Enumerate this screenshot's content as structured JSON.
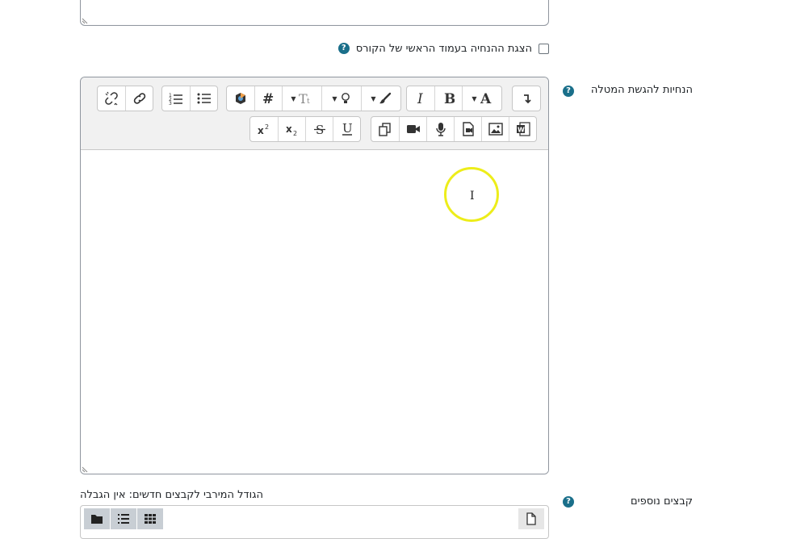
{
  "form": {
    "show_description_label": "הצגת ההנחיה בעמוד הראשי של הקורס",
    "show_description_checked": false,
    "submission_instructions_label": "הנחיות להגשת המטלה",
    "additional_files_label": "קבצים נוספים",
    "max_file_size_text": "הגודל המירבי לקבצים חדשים: אין הגבלה",
    "help_glyph": "?"
  },
  "editor": {
    "toolbar_row1": [
      {
        "name": "expand-toolbar-button",
        "icon": "arrow-toggle-icon"
      },
      {
        "name": "font-color-button",
        "icon": "font-color-icon",
        "label": "A"
      },
      {
        "name": "bold-button",
        "icon": "bold-icon",
        "label": "B"
      },
      {
        "name": "italic-button",
        "icon": "italic-icon",
        "label": "I"
      },
      {
        "name": "background-color-button",
        "icon": "brush-icon"
      },
      {
        "name": "styles-button",
        "icon": "lightbulb-icon"
      },
      {
        "name": "font-size-button",
        "icon": "text-size-icon"
      },
      {
        "name": "wiris-button",
        "icon": "hashtag-icon",
        "label": "#"
      },
      {
        "name": "h5p-button",
        "icon": "h5p-icon"
      },
      {
        "name": "unordered-list-button",
        "icon": "bullet-list-icon"
      },
      {
        "name": "ordered-list-button",
        "icon": "numbered-list-icon"
      },
      {
        "name": "link-button",
        "icon": "link-icon"
      },
      {
        "name": "unlink-button",
        "icon": "unlink-icon"
      }
    ],
    "toolbar_row2": [
      {
        "name": "word-import-button",
        "icon": "word-icon"
      },
      {
        "name": "insert-image-button",
        "icon": "image-icon"
      },
      {
        "name": "insert-media-button",
        "icon": "media-file-icon"
      },
      {
        "name": "record-audio-button",
        "icon": "microphone-icon"
      },
      {
        "name": "record-video-button",
        "icon": "video-camera-icon"
      },
      {
        "name": "manage-files-button",
        "icon": "copy-files-icon"
      },
      {
        "name": "underline-button",
        "icon": "underline-icon",
        "label": "U"
      },
      {
        "name": "strikethrough-button",
        "icon": "strikethrough-icon",
        "label": "S"
      },
      {
        "name": "subscript-button",
        "icon": "subscript-icon",
        "label": "x₂"
      },
      {
        "name": "superscript-button",
        "icon": "superscript-icon",
        "label": "x²"
      }
    ],
    "content": ""
  },
  "filepicker": {
    "buttons": [
      {
        "name": "folder-view",
        "icon": "folder-icon"
      },
      {
        "name": "list-view",
        "icon": "list-icon"
      },
      {
        "name": "grid-view",
        "icon": "grid-icon"
      },
      {
        "name": "add-file",
        "icon": "file-icon"
      }
    ]
  },
  "colors": {
    "help_icon": "#1a6f8a",
    "toolbar_bg": "#f1f1f1",
    "cursor_highlight": "#eded1a",
    "border": "#8f959e"
  }
}
